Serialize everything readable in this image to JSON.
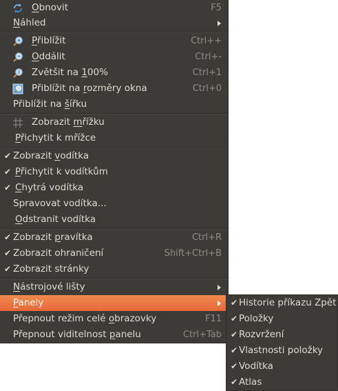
{
  "menu": {
    "items": [
      {
        "check": "",
        "icon": "refresh-icon",
        "pre": "",
        "u": "O",
        "post": "bnovit",
        "shortcut": "F5"
      },
      {
        "check": "",
        "icon": "",
        "pre": "",
        "u": "N",
        "post": "áhled",
        "shortcut": ""
      },
      {
        "check": "",
        "icon": "zoom-in-icon",
        "pre": "",
        "u": "P",
        "post": "řiblížit",
        "shortcut": "Ctrl++"
      },
      {
        "check": "",
        "icon": "zoom-out-icon",
        "pre": "",
        "u": "O",
        "post": "ddálit",
        "shortcut": "Ctrl+-"
      },
      {
        "check": "",
        "icon": "zoom-100-icon",
        "pre": "Zvětšit na ",
        "u": "1",
        "post": "00%",
        "shortcut": "Ctrl+1"
      },
      {
        "check": "",
        "icon": "zoom-fit-icon",
        "pre": "Přiblížit na ",
        "u": "r",
        "post": "ozměry okna",
        "shortcut": "Ctrl+0"
      },
      {
        "check": "",
        "icon": "",
        "pre": "Přiblížit na ",
        "u": "š",
        "post": "ířku",
        "shortcut": ""
      },
      {
        "check": "",
        "icon": "grid-icon",
        "pre": "Zobrazit ",
        "u": "m",
        "post": "řížku",
        "shortcut": ""
      },
      {
        "check": "",
        "icon": "",
        "pre": "",
        "u": "P",
        "post": "řichytit k mřížce",
        "shortcut": ""
      },
      {
        "check": "✔",
        "icon": "",
        "pre": "Zobrazit ",
        "u": "v",
        "post": "odítka",
        "shortcut": ""
      },
      {
        "check": "✔",
        "icon": "",
        "pre": "",
        "u": "P",
        "post": "řichytit k vodítkům",
        "shortcut": ""
      },
      {
        "check": "✔",
        "icon": "",
        "pre": "",
        "u": "C",
        "post": "hytrá vodítka",
        "shortcut": ""
      },
      {
        "check": "",
        "icon": "",
        "pre": "Spravovat vodítka...",
        "u": "",
        "post": "",
        "shortcut": ""
      },
      {
        "check": "",
        "icon": "",
        "pre": "",
        "u": "O",
        "post": "dstranit vodítka",
        "shortcut": ""
      },
      {
        "check": "✔",
        "icon": "",
        "pre": "Zobrazit ",
        "u": "p",
        "post": "ravítka",
        "shortcut": "Ctrl+R"
      },
      {
        "check": "✔",
        "icon": "",
        "pre": "Zobrazit ohraničení",
        "u": "",
        "post": "",
        "shortcut": "Shift+Ctrl+B"
      },
      {
        "check": "✔",
        "icon": "",
        "pre": "Zobrazit stránky",
        "u": "",
        "post": "",
        "shortcut": ""
      },
      {
        "check": "",
        "icon": "",
        "pre": "",
        "u": "N",
        "post": "ástrojové lišty",
        "shortcut": ""
      },
      {
        "check": "",
        "icon": "",
        "pre": "",
        "u": "P",
        "post": "anely",
        "shortcut": ""
      },
      {
        "check": "",
        "icon": "",
        "pre": "Přepnout režim celé ",
        "u": "o",
        "post": "brazovky",
        "shortcut": "F11"
      },
      {
        "check": "",
        "icon": "",
        "pre": "Přepnout viditelnost ",
        "u": "p",
        "post": "anelu",
        "shortcut": "Ctrl+Tab"
      }
    ]
  },
  "submenu": {
    "items": [
      {
        "check": "✔",
        "label": "Historie příkazu Zpět"
      },
      {
        "check": "✔",
        "label": "Položky"
      },
      {
        "check": "✔",
        "label": "Rozvržení"
      },
      {
        "check": "✔",
        "label": "Vlastnosti položky"
      },
      {
        "check": "✔",
        "label": "Vodítka"
      },
      {
        "check": "✔",
        "label": "Atlas"
      }
    ]
  },
  "colors": {
    "menu_bg": "#3c3b37",
    "text": "#dfdbd2",
    "shortcut": "#8f8b84",
    "highlight": "#e8673a"
  }
}
